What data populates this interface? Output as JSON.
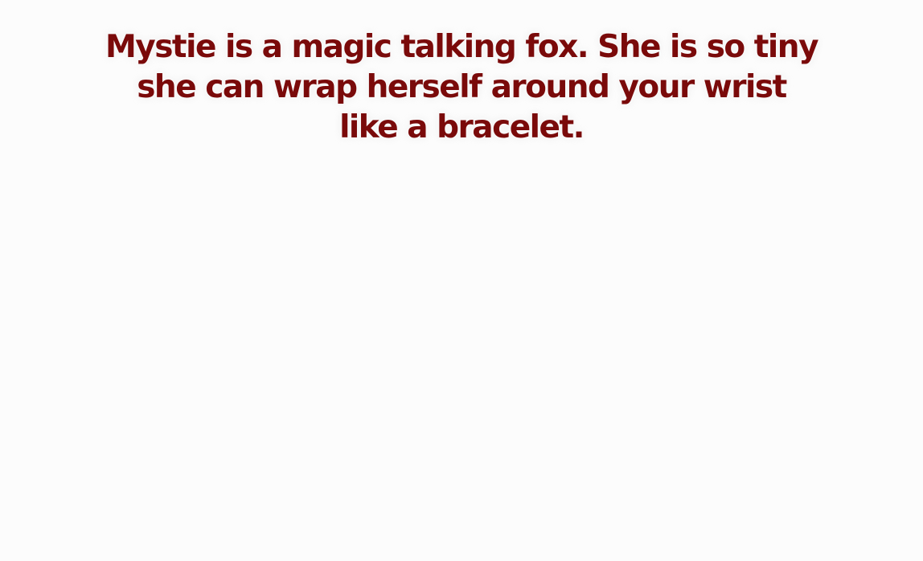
{
  "caption": {
    "lines": [
      "Mystie is a magic talking fox.  She is so tiny",
      "she can wrap herself around your wrist",
      "like a bracelet."
    ],
    "color": "#7a0a0a"
  }
}
